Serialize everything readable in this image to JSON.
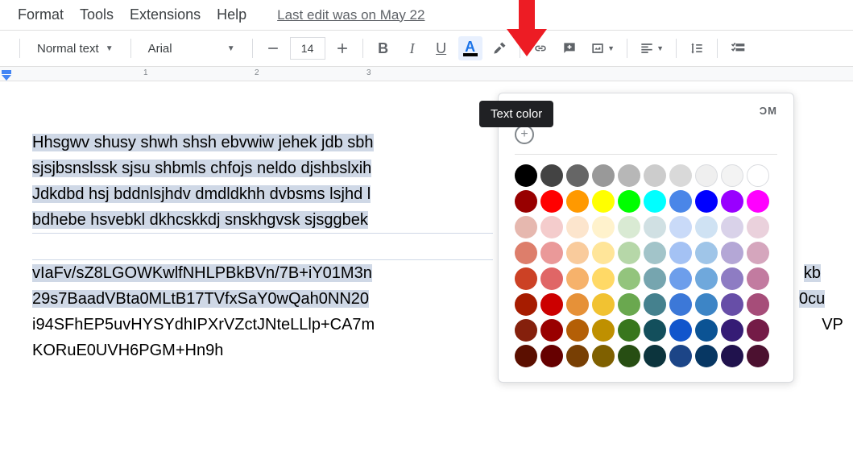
{
  "menubar": {
    "items": [
      "Format",
      "Tools",
      "Extensions",
      "Help"
    ],
    "last_edit": "Last edit was on May 22"
  },
  "toolbar": {
    "style_dropdown": "Normal text",
    "font_dropdown": "Arial",
    "font_size": "14"
  },
  "tooltip": "Text color",
  "popup": {
    "header": "ϽM"
  },
  "ruler": {
    "nums": [
      "1",
      "2",
      "3"
    ]
  },
  "document": {
    "lines": [
      "Hhsgwv shusy shwh shsh ebvwiw jehek jdb sbh",
      "sjsjbsnslssk sjsu shbmls chfojs neldo djshbslxih",
      "Jdkdbd hsj bddnlsjhdv dmdldkhh dvbsms lsjhd l",
      "bdhebe hsvebkl dkhcskkdj snskhgvsk sjsggbek",
      "vIaFv/sZ8LGOWKwlfNHLPBkBVn/7B+iY01M3n",
      "29s7BaadVBta0MLtB17TVfxSaY0wQah0NN20",
      "i94SFhEP5uvHYSYdhIPXrVZctJNteLLlp+CA7m",
      "KORuE0UVH6PGM+Hn9h"
    ],
    "tail5": "kb",
    "tail6": "0cu",
    "tail7": "VP"
  },
  "colors": {
    "row0": [
      "#000000",
      "#434343",
      "#666666",
      "#999999",
      "#b7b7b7",
      "#cccccc",
      "#d9d9d9",
      "#efefef",
      "#f3f3f3",
      "#ffffff"
    ],
    "row1": [
      "#980000",
      "#ff0000",
      "#ff9900",
      "#ffff00",
      "#00ff00",
      "#00ffff",
      "#4a86e8",
      "#0000ff",
      "#9900ff",
      "#ff00ff"
    ],
    "row2": [
      "#e6b8af",
      "#f4cccc",
      "#fce5cd",
      "#fff2cc",
      "#d9ead3",
      "#d0e0e3",
      "#c9daf8",
      "#cfe2f3",
      "#d9d2e9",
      "#ead1dc"
    ],
    "row3": [
      "#dd7e6b",
      "#ea9999",
      "#f9cb9c",
      "#ffe599",
      "#b6d7a8",
      "#a2c4c9",
      "#a4c2f4",
      "#9fc5e8",
      "#b4a7d6",
      "#d5a6bd"
    ],
    "row4": [
      "#cc4125",
      "#e06666",
      "#f6b26b",
      "#ffd966",
      "#93c47d",
      "#76a5af",
      "#6d9eeb",
      "#6fa8dc",
      "#8e7cc3",
      "#c27ba0"
    ],
    "row5": [
      "#a61c00",
      "#cc0000",
      "#e69138",
      "#f1c232",
      "#6aa84f",
      "#45818e",
      "#3c78d8",
      "#3d85c6",
      "#674ea7",
      "#a64d79"
    ],
    "row6": [
      "#85200c",
      "#990000",
      "#b45f06",
      "#bf9000",
      "#38761d",
      "#134f5c",
      "#1155cc",
      "#0b5394",
      "#351c75",
      "#741b47"
    ],
    "row7": [
      "#5b0f00",
      "#660000",
      "#783f04",
      "#7f6000",
      "#274e13",
      "#0c343d",
      "#1c4587",
      "#073763",
      "#20124d",
      "#4c1130"
    ]
  }
}
